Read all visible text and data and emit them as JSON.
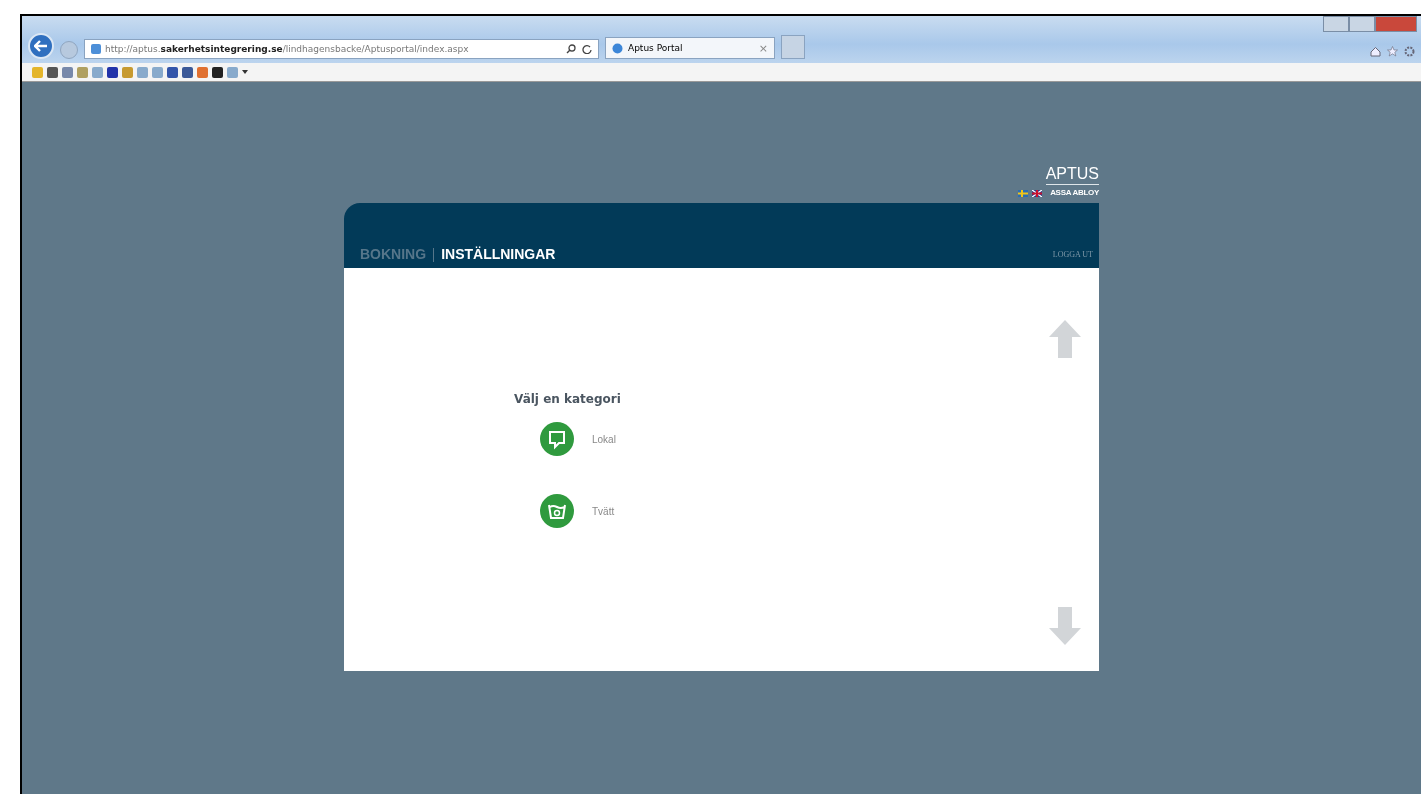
{
  "browser": {
    "url": "http://aptus.**sakerhetsintegrering.se**/lindhagensbacke/Aptusportal/index.aspx",
    "tab_title": "Aptus Portal",
    "tab_close": "×"
  },
  "logo": {
    "brand": "APTUS",
    "parent": "ASSA ABLOY"
  },
  "nav": [
    {
      "label": "BOKNING",
      "selected": false
    },
    {
      "label": "INSTÄLLNINGAR",
      "selected": true
    }
  ],
  "logout": "LOGGA UT",
  "heading": "Välj en kategori",
  "categories": [
    {
      "label": "Lokal",
      "kind": "room"
    },
    {
      "label": "Tvätt",
      "kind": "laundry"
    }
  ]
}
